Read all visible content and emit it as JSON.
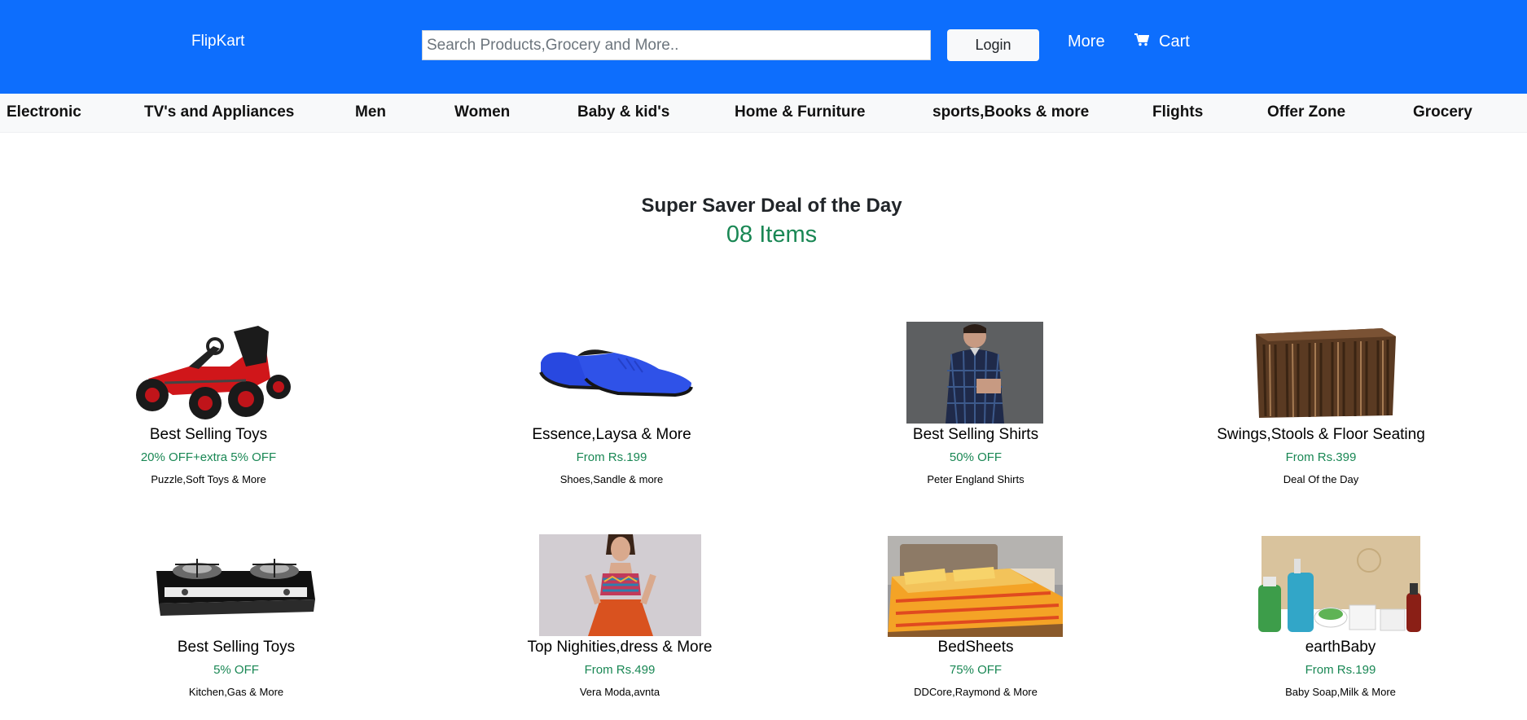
{
  "header": {
    "brand": "FlipKart",
    "search_placeholder": "Search Products,Grocery and More..",
    "login_label": "Login",
    "more_label": "More",
    "cart_label": "Cart"
  },
  "categories": [
    "Electronic",
    "TV's and Appliances",
    "Men",
    "Women",
    "Baby & kid's",
    "Home & Furniture",
    "sports,Books & more",
    "Flights",
    "Offer Zone",
    "Grocery"
  ],
  "deal": {
    "title": "Super Saver Deal of the Day",
    "count": "08 Items"
  },
  "products": [
    {
      "name": "Best Selling Toys",
      "offer": "20% OFF+extra 5% OFF",
      "sub": "Puzzle,Soft Toys & More",
      "image": "go-kart-toy"
    },
    {
      "name": "Essence,Laysa & More",
      "offer": "From Rs.199",
      "sub": "Shoes,Sandle & more",
      "image": "blue-shoes"
    },
    {
      "name": "Best Selling Shirts",
      "offer": "50% OFF",
      "sub": "Peter England Shirts",
      "image": "checked-shirt-model"
    },
    {
      "name": "Swings,Stools & Floor Seating",
      "offer": "From Rs.399",
      "sub": "Deal Of the Day",
      "image": "wooden-stool"
    },
    {
      "name": "Best Selling Toys",
      "offer": "5% OFF",
      "sub": "Kitchen,Gas & More",
      "image": "gas-stove"
    },
    {
      "name": "Top Nighities,dress & More",
      "offer": "From Rs.499",
      "sub": "Vera Moda,avnta",
      "image": "dress-model"
    },
    {
      "name": "BedSheets",
      "offer": "75% OFF",
      "sub": "DDCore,Raymond & More",
      "image": "bedsheet"
    },
    {
      "name": "earthBaby",
      "offer": "From Rs.199",
      "sub": "Baby Soap,Milk & More",
      "image": "baby-products"
    }
  ],
  "colors": {
    "primary": "#0d6efd",
    "success": "#198754",
    "light": "#f8f9fa"
  }
}
